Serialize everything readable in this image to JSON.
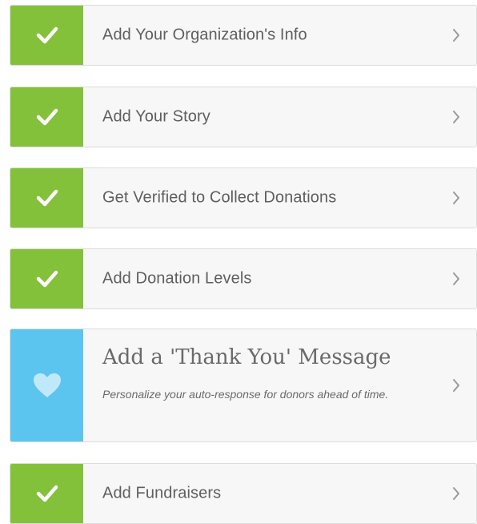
{
  "colors": {
    "done": "#84c13b",
    "current": "#5cc5ef",
    "row_bg": "#f7f7f7",
    "text": "#5f5f5f",
    "chevron": "#9a9a9a"
  },
  "steps": [
    {
      "label": "Add Your Organization's Info",
      "status": "done",
      "icon": "check-icon"
    },
    {
      "label": "Add Your Story",
      "status": "done",
      "icon": "check-icon"
    },
    {
      "label": "Get Verified to Collect Donations",
      "status": "done",
      "icon": "check-icon"
    },
    {
      "label": "Add Donation Levels",
      "status": "done",
      "icon": "check-icon"
    },
    {
      "label": "Add a 'Thank You' Message",
      "description": "Personalize your auto-response for donors ahead of time.",
      "status": "current",
      "icon": "heart-icon"
    },
    {
      "label": "Add Fundraisers",
      "status": "done",
      "icon": "check-icon"
    }
  ]
}
